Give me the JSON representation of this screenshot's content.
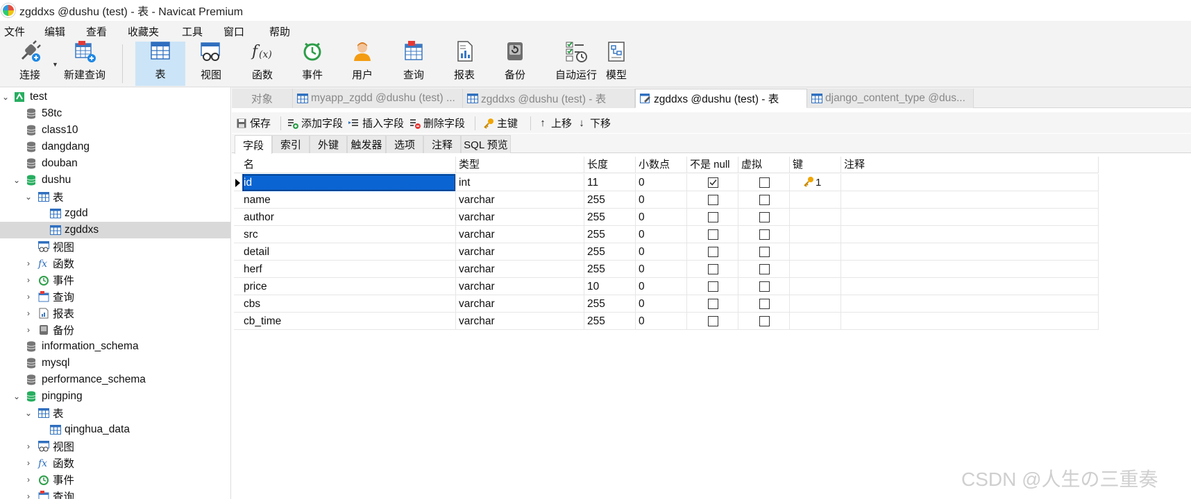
{
  "window": {
    "title": "zgddxs @dushu (test) - 表 - Navicat Premium"
  },
  "menu": [
    "文件",
    "编辑",
    "查看",
    "收藏夹",
    "工具",
    "窗口",
    "帮助"
  ],
  "toolbar": {
    "items": [
      {
        "label": "连接",
        "icon": "plug-icon"
      },
      {
        "label": "新建查询",
        "icon": "new-query-icon"
      },
      {
        "label": "表",
        "icon": "table-icon",
        "active": true
      },
      {
        "label": "视图",
        "icon": "view-icon"
      },
      {
        "label": "函数",
        "icon": "function-icon"
      },
      {
        "label": "事件",
        "icon": "clock-icon"
      },
      {
        "label": "用户",
        "icon": "user-icon"
      },
      {
        "label": "查询",
        "icon": "query-icon"
      },
      {
        "label": "报表",
        "icon": "report-icon"
      },
      {
        "label": "备份",
        "icon": "backup-icon"
      },
      {
        "label": "自动运行",
        "icon": "automation-icon"
      },
      {
        "label": "模型",
        "icon": "model-icon"
      }
    ]
  },
  "tree": {
    "items": [
      {
        "label": "test",
        "kind": "connection",
        "expanded": true
      },
      {
        "label": "58tc",
        "kind": "db"
      },
      {
        "label": "class10",
        "kind": "db"
      },
      {
        "label": "dangdang",
        "kind": "db"
      },
      {
        "label": "douban",
        "kind": "db"
      },
      {
        "label": "dushu",
        "kind": "db-open",
        "expanded": true
      },
      {
        "label": "表",
        "kind": "tables",
        "expanded": true
      },
      {
        "label": "zgdd",
        "kind": "table"
      },
      {
        "label": "zgddxs",
        "kind": "table",
        "selected": true
      },
      {
        "label": "视图",
        "kind": "views"
      },
      {
        "label": "函数",
        "kind": "functions"
      },
      {
        "label": "事件",
        "kind": "events"
      },
      {
        "label": "查询",
        "kind": "queries"
      },
      {
        "label": "报表",
        "kind": "reports"
      },
      {
        "label": "备份",
        "kind": "backups"
      },
      {
        "label": "information_schema",
        "kind": "db"
      },
      {
        "label": "mysql",
        "kind": "db"
      },
      {
        "label": "performance_schema",
        "kind": "db"
      },
      {
        "label": "pingping",
        "kind": "db-open",
        "expanded": true
      },
      {
        "label": "表",
        "kind": "tables",
        "expanded": true
      },
      {
        "label": "qinghua_data",
        "kind": "table"
      },
      {
        "label": "视图",
        "kind": "views"
      },
      {
        "label": "函数",
        "kind": "functions"
      },
      {
        "label": "事件",
        "kind": "events"
      },
      {
        "label": "查询",
        "kind": "queries"
      }
    ]
  },
  "tabs": [
    {
      "label": "对象"
    },
    {
      "label": "myapp_zgdd @dushu (test) ..."
    },
    {
      "label": "zgddxs @dushu (test) - 表"
    },
    {
      "label": "zgddxs @dushu (test) - 表",
      "active": true
    },
    {
      "label": "django_content_type @dus..."
    }
  ],
  "editor_toolbar": {
    "save": "保存",
    "add_field": "添加字段",
    "insert_field": "插入字段",
    "delete_field": "删除字段",
    "primary_key": "主键",
    "move_up": "上移",
    "move_down": "下移"
  },
  "subtabs": [
    "字段",
    "索引",
    "外键",
    "触发器",
    "选项",
    "注释",
    "SQL 预览"
  ],
  "grid": {
    "columns": [
      "名",
      "类型",
      "长度",
      "小数点",
      "不是 null",
      "虚拟",
      "键",
      "注释"
    ],
    "rows": [
      {
        "name": "id",
        "type": "int",
        "length": "11",
        "decimals": "0",
        "not_null": true,
        "virtual": false,
        "key": "1"
      },
      {
        "name": "name",
        "type": "varchar",
        "length": "255",
        "decimals": "0",
        "not_null": false,
        "virtual": false,
        "key": ""
      },
      {
        "name": "author",
        "type": "varchar",
        "length": "255",
        "decimals": "0",
        "not_null": false,
        "virtual": false,
        "key": ""
      },
      {
        "name": "src",
        "type": "varchar",
        "length": "255",
        "decimals": "0",
        "not_null": false,
        "virtual": false,
        "key": ""
      },
      {
        "name": "detail",
        "type": "varchar",
        "length": "255",
        "decimals": "0",
        "not_null": false,
        "virtual": false,
        "key": ""
      },
      {
        "name": "herf",
        "type": "varchar",
        "length": "255",
        "decimals": "0",
        "not_null": false,
        "virtual": false,
        "key": ""
      },
      {
        "name": "price",
        "type": "varchar",
        "length": "10",
        "decimals": "0",
        "not_null": false,
        "virtual": false,
        "key": ""
      },
      {
        "name": "cbs",
        "type": "varchar",
        "length": "255",
        "decimals": "0",
        "not_null": false,
        "virtual": false,
        "key": ""
      },
      {
        "name": "cb_time",
        "type": "varchar",
        "length": "255",
        "decimals": "0",
        "not_null": false,
        "virtual": false,
        "key": ""
      }
    ]
  },
  "watermark": "CSDN @人生の三重奏",
  "colors": {
    "selection": "#0a64d2",
    "active_tool": "#cce4f7",
    "tree_selected": "#d9d9d9"
  }
}
